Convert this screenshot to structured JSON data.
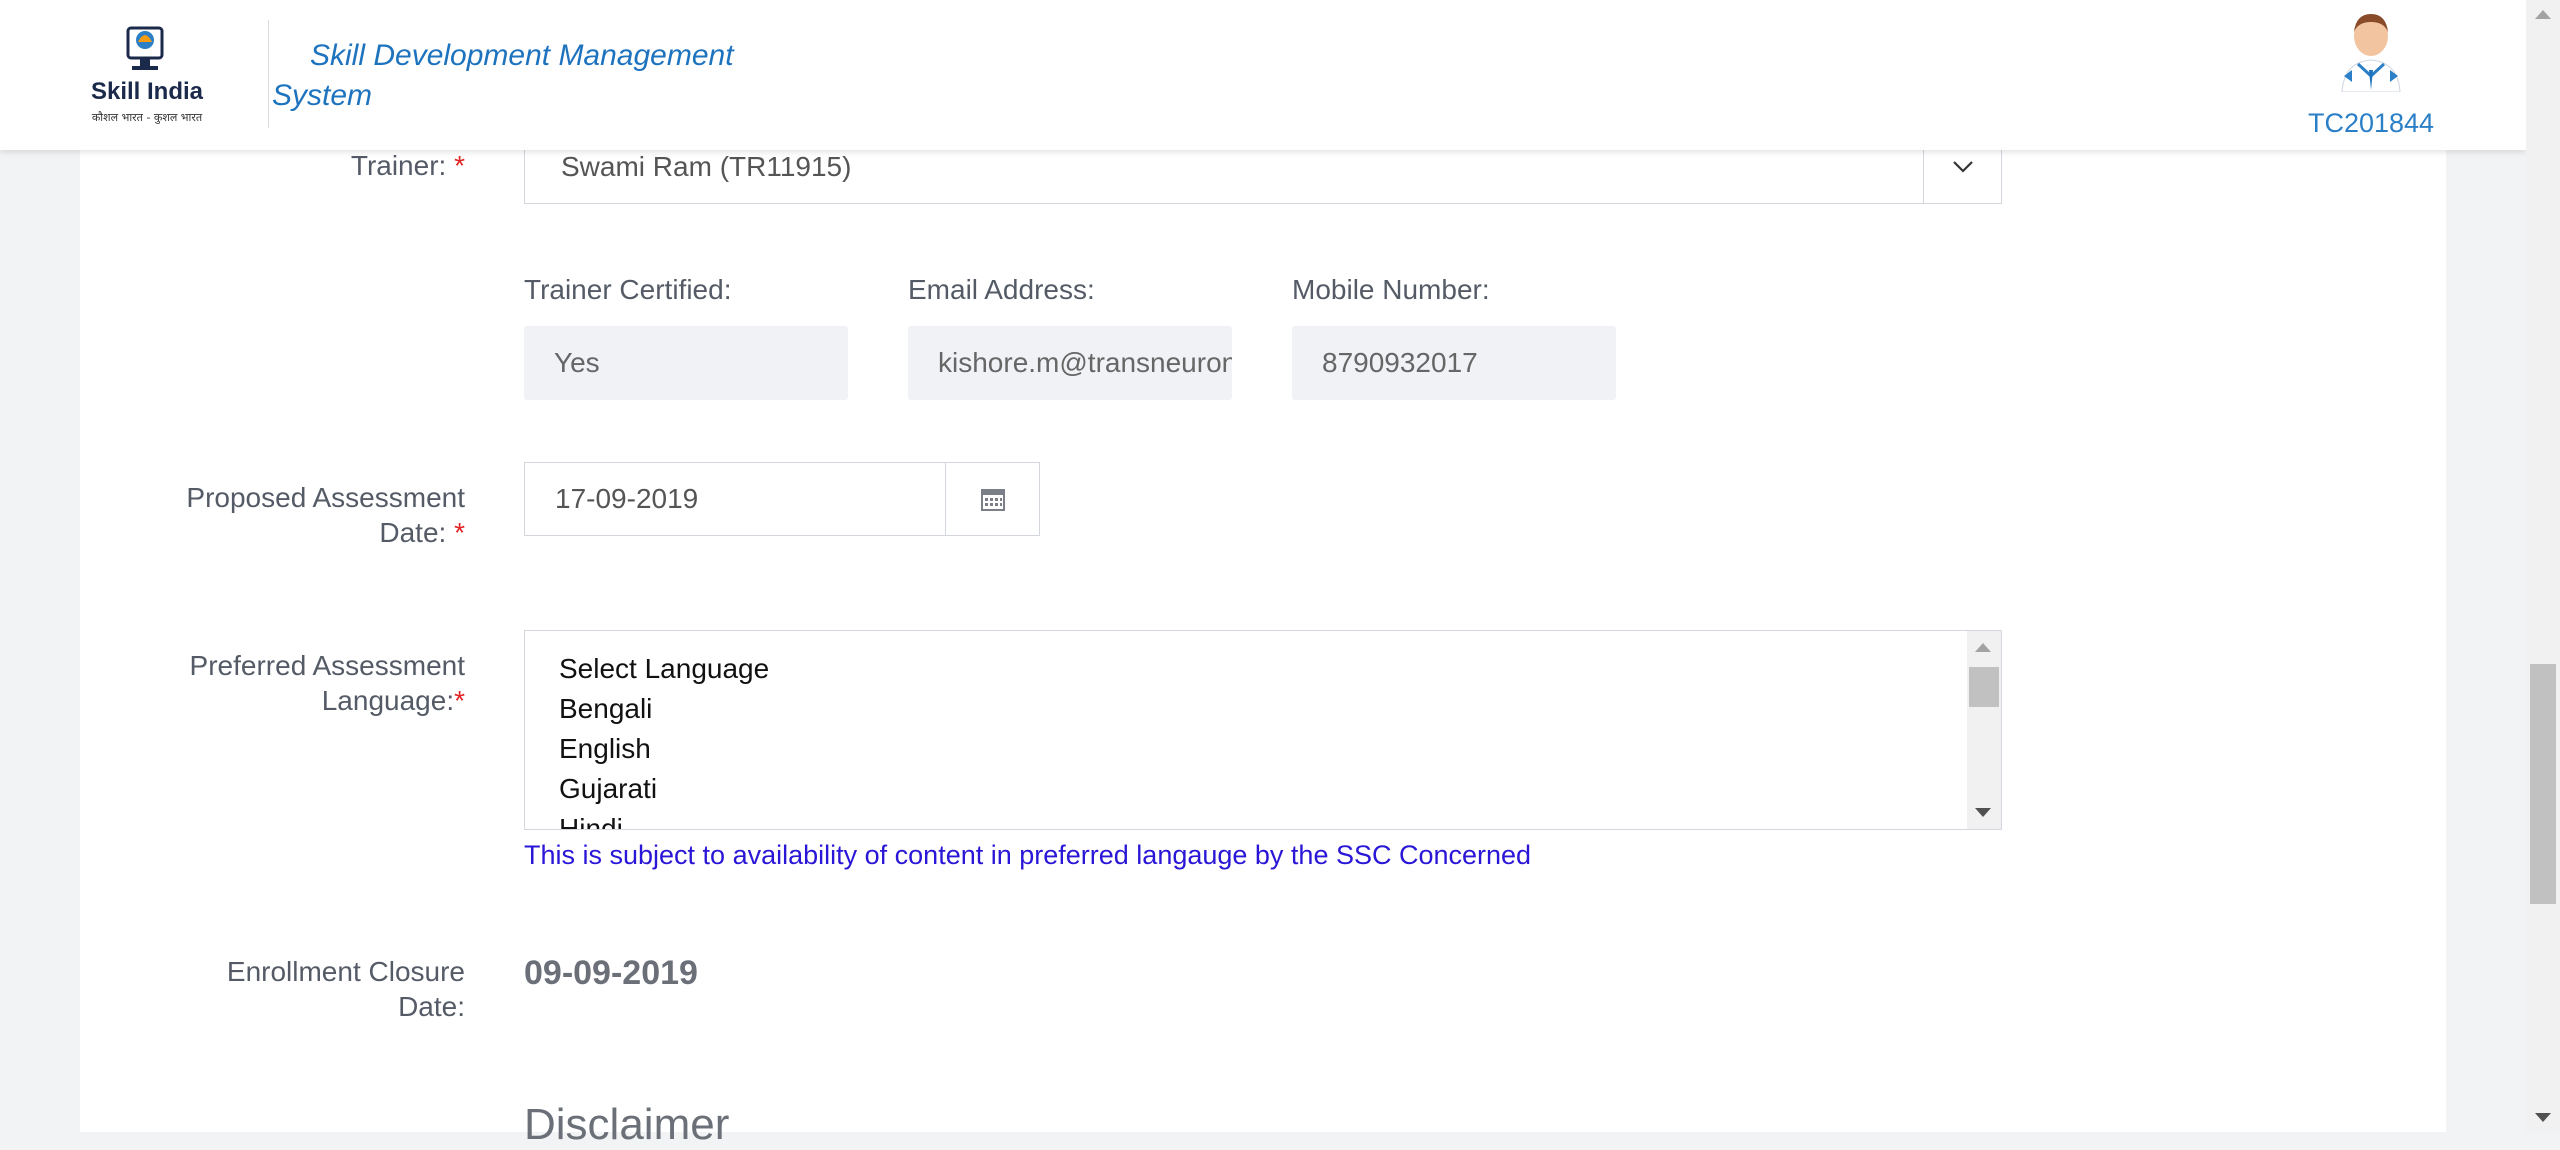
{
  "header": {
    "logo_text": "Skill India",
    "logo_subtext": "कौशल भारत - कुशल भारत",
    "title_line1": "Skill Development Management",
    "title_line2": "System",
    "user_id": "TC201844"
  },
  "form": {
    "trainer": {
      "label": "Trainer:",
      "required_mark": "*",
      "value": "Swami Ram (TR11915)"
    },
    "trainer_certified": {
      "label": "Trainer Certified:",
      "value": "Yes"
    },
    "email": {
      "label": "Email Address:",
      "value": "kishore.m@transneuron.com"
    },
    "mobile": {
      "label": "Mobile Number:",
      "value": "8790932017"
    },
    "assessment_date": {
      "label_line1": "Proposed Assessment",
      "label_line2": "Date:",
      "required_mark": "*",
      "value": "17-09-2019"
    },
    "language": {
      "label_line1": "Preferred Assessment",
      "label_line2": "Language:",
      "required_mark": "*",
      "options": [
        "Select Language",
        "Bengali",
        "English",
        "Gujarati",
        "Hindi"
      ],
      "note": "This is subject to availability of content in preferred langauge by the SSC Concerned"
    },
    "enrollment_closure": {
      "label_line1": "Enrollment Closure",
      "label_line2": "Date:",
      "value": "09-09-2019"
    },
    "disclaimer_heading": "Disclaimer"
  }
}
